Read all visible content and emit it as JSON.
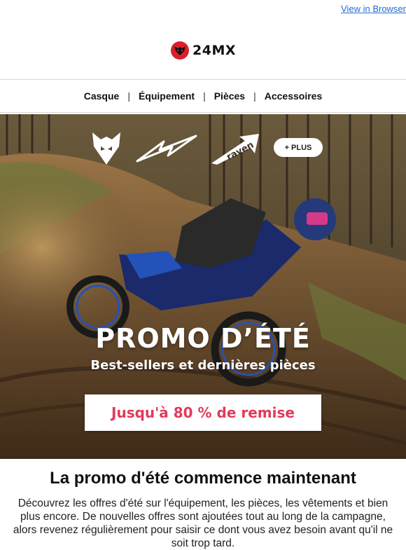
{
  "header": {
    "view_in_browser": "View in Browser",
    "logo_text": "24MX"
  },
  "nav": {
    "items": [
      "Casque",
      "Équipement",
      "Pièces",
      "Accessoires"
    ],
    "separator": "|"
  },
  "hero": {
    "brands": [
      "fox-logo-icon",
      "alpinestars-logo-icon",
      "raven-logo-icon"
    ],
    "raven_text": "raven",
    "plus_label": "+ PLUS",
    "headline": "PROMO D’ÉTÉ",
    "subline": "Best-sellers et dernières pièces",
    "cta_label": "Jusqu'à 80 % de remise",
    "cta_color": "#e23a5c"
  },
  "content": {
    "title": "La promo d'été commence maintenant",
    "body": "Découvrez les offres d'été sur l'équipement, les pièces, les vêtements et bien plus encore. De nouvelles offres sont ajoutées tout au long de la campagne, alors revenez régulièrement pour saisir ce dont vous avez besoin avant qu'il ne soit trop tard."
  },
  "colors": {
    "link": "#1f6fd1",
    "brand_red": "#d8202a"
  }
}
